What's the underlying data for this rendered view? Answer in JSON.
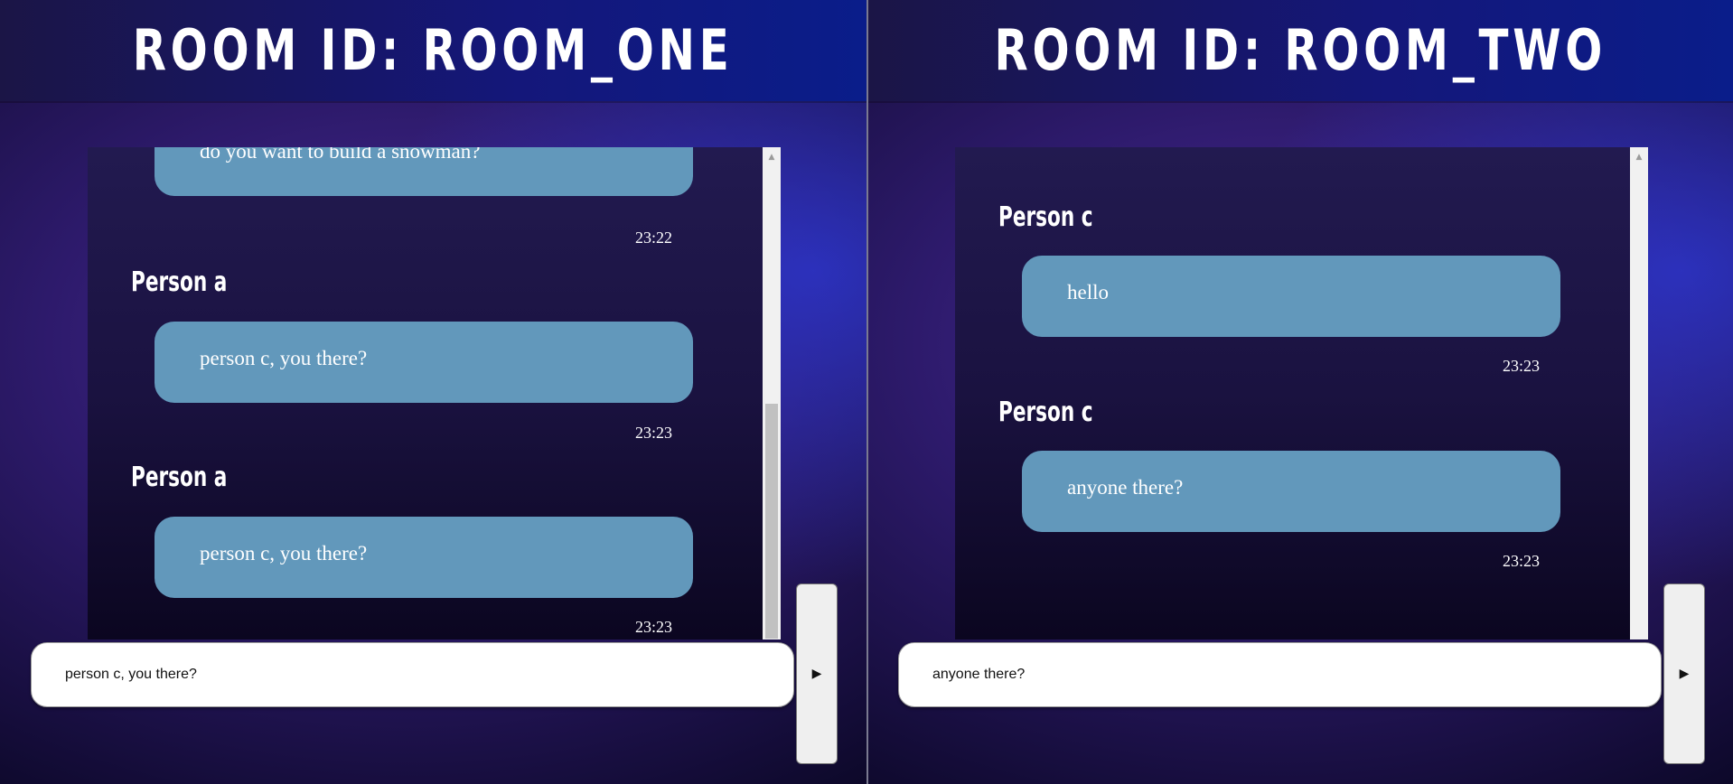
{
  "rooms": [
    {
      "title": "ROOM ID: ROOM_ONE",
      "messages": [
        {
          "sender": "",
          "text": "do you want to build a snowman?",
          "time": "23:22"
        },
        {
          "sender": "Person a",
          "text": "person c, you there?",
          "time": "23:23"
        },
        {
          "sender": "Person a",
          "text": "person c, you there?",
          "time": "23:23"
        }
      ],
      "input_value": "person c, you there?",
      "send_icon": "▶",
      "scroll_up_icon": "▲"
    },
    {
      "title": "ROOM ID: ROOM_TWO",
      "messages": [
        {
          "sender": "Person c",
          "text": "hello",
          "time": "23:23"
        },
        {
          "sender": "Person c",
          "text": "anyone there?",
          "time": "23:23"
        }
      ],
      "input_value": "anyone there?",
      "send_icon": "▶",
      "scroll_up_icon": "▲"
    }
  ],
  "colors": {
    "bubble": "#6298bb",
    "header": "#14177a",
    "background": "#2d1a6b"
  }
}
